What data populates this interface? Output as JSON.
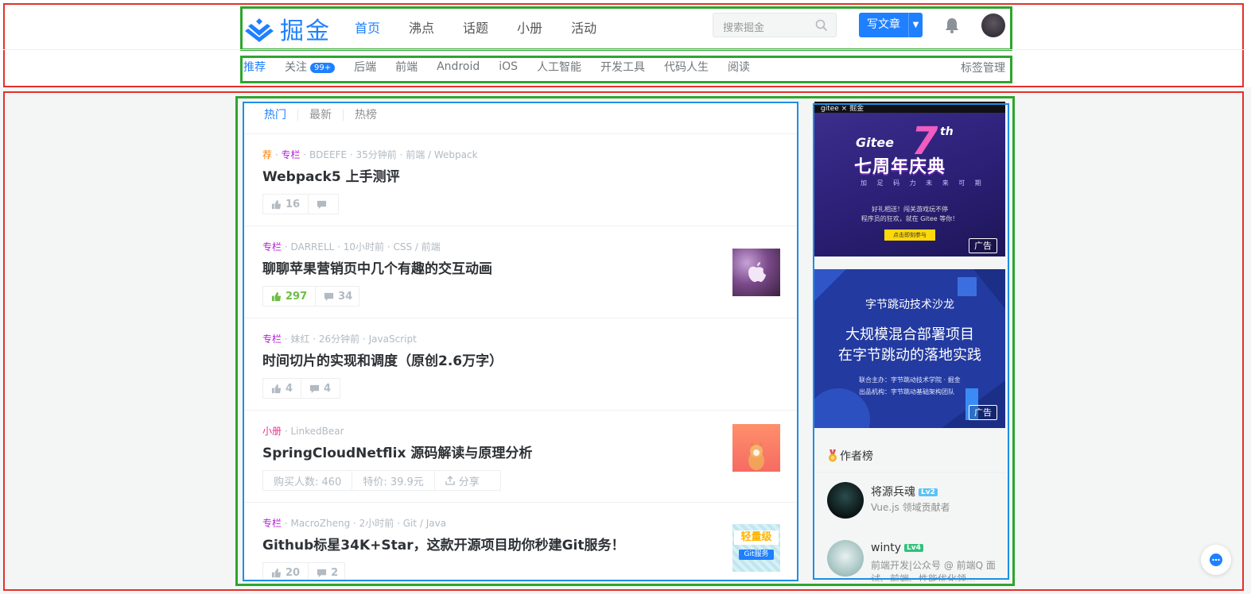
{
  "header": {
    "logo_text": "掘金",
    "nav": [
      "首页",
      "沸点",
      "话题",
      "小册",
      "活动"
    ],
    "search_placeholder": "搜索掘金",
    "write_label": "写文章"
  },
  "subnav": {
    "items": [
      "推荐",
      "关注",
      "后端",
      "前端",
      "Android",
      "iOS",
      "人工智能",
      "开发工具",
      "代码人生",
      "阅读"
    ],
    "follow_badge": "99+",
    "tag_manage": "标签管理"
  },
  "feed": {
    "tabs": [
      "热门",
      "最新",
      "热榜"
    ],
    "items": [
      {
        "tag1": "荐",
        "tag2": "专栏",
        "meta": "BDEEFE · 35分钟前 · 前端 / Webpack",
        "title": "Webpack5 上手测评",
        "likes": "16",
        "comments": ""
      },
      {
        "tag": "专栏",
        "meta": "DARRELL · 10小时前 · CSS / 前端",
        "title": "聊聊苹果营销页中几个有趣的交互动画",
        "likes": "297",
        "comments": "34"
      },
      {
        "tag": "专栏",
        "meta": "妹红 · 26分钟前 · JavaScript",
        "title": "时间切片的实现和调度（原创2.6万字）",
        "likes": "4",
        "comments": "4"
      },
      {
        "tag": "小册",
        "meta": "LinkedBear",
        "title": "SpringCloudNetflix 源码解读与原理分析",
        "buyers": "购买人数: 460",
        "price": "特价: 39.9元",
        "share": "分享"
      },
      {
        "tag": "专栏",
        "meta": "MacroZheng · 2小时前 · Git / Java",
        "title": "Github标星34K+Star，这款开源项目助你秒建Git服务！",
        "likes": "20",
        "comments": "2",
        "thumb_text1": "轻量级",
        "thumb_text2": "Git服务"
      }
    ]
  },
  "sidebar": {
    "ad1": {
      "strip": "gitee × 掘金",
      "gitee": "Gitee",
      "seven": "7",
      "th": "th",
      "headline": "七周年庆典",
      "sub": "加 足 码 力   未 来 可 期",
      "text1": "好礼相送！闯关游戏玩不停",
      "text2": "程序员的狂欢，就在 Gitee 等你！",
      "button": "点击即刻参与",
      "tag": "广告"
    },
    "ad2": {
      "heading": "字节跳动技术沙龙",
      "line1": "大规模混合部署项目",
      "line2": "在字节跳动的落地实践",
      "sponsor": "联合主办：字节跳动技术学院 · 掘金",
      "org": "出品机构：字节跳动基础架构团队",
      "tag": "广告"
    },
    "authors_title": "作者榜",
    "authors": [
      {
        "name": "将源兵魂",
        "level": "Lv2",
        "desc": "Vue.js 领域贡献者"
      },
      {
        "name": "winty",
        "level": "Lv4",
        "desc": "前端开发|公众号 @ 前端Q 面试、前端、性能优化领..."
      }
    ]
  }
}
